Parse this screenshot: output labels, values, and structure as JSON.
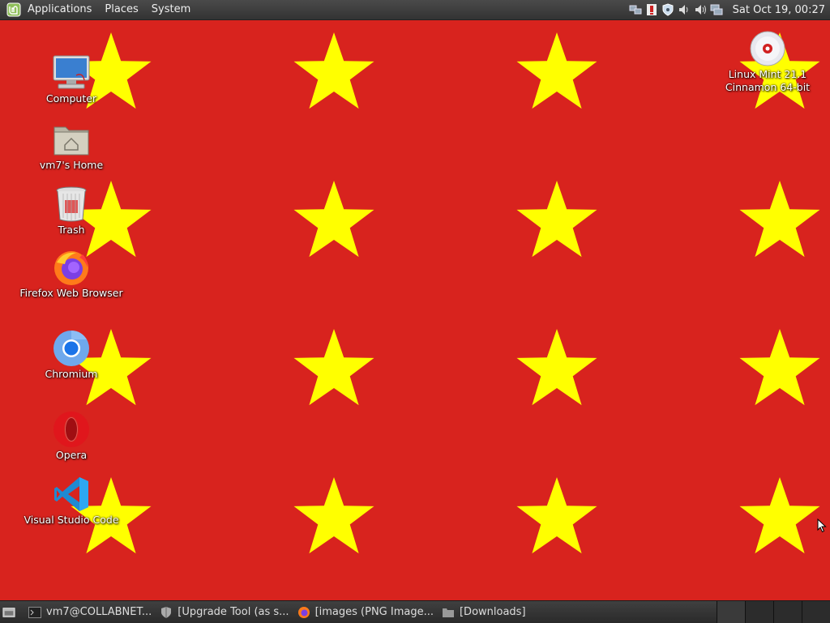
{
  "top_panel": {
    "menus": [
      "Applications",
      "Places",
      "System"
    ],
    "clock": "Sat Oct 19, 00:27",
    "tray_icons": [
      "network-icon",
      "update-icon",
      "shield-icon",
      "volume-icon",
      "volume-icon",
      "network-display-icon"
    ]
  },
  "desktop": {
    "wallpaper": {
      "background": "#d8231e",
      "star_color": "#ffff00"
    },
    "icons": {
      "computer": "Computer",
      "home": "vm7's Home",
      "trash": "Trash",
      "firefox": "Firefox Web Browser",
      "chromium": "Chromium",
      "opera": "Opera",
      "vscode": "Visual Studio Code",
      "disc": "Linux Mint 21.1\nCinnamon 64-bit"
    }
  },
  "taskbar": {
    "tasks": [
      {
        "label": "vm7@COLLABNET...",
        "icon": "terminal-icon"
      },
      {
        "label": "[Upgrade Tool (as s...",
        "icon": "shield-icon"
      },
      {
        "label": "[images (PNG Image...",
        "icon": "firefox-icon"
      },
      {
        "label": "[Downloads]",
        "icon": "folder-icon"
      }
    ]
  }
}
